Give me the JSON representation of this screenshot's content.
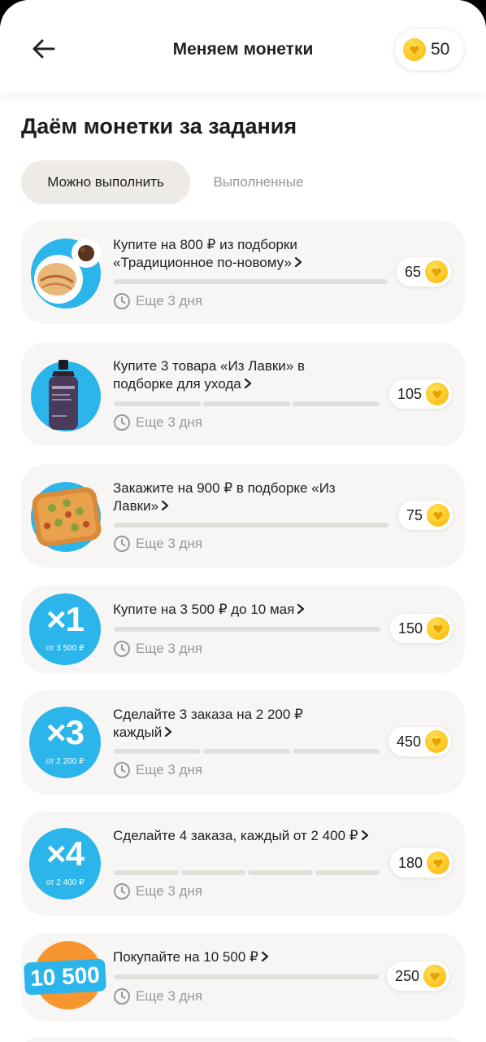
{
  "header": {
    "title": "Меняем монетки",
    "balance": "50"
  },
  "section_title": "Даём монетки за задания",
  "tabs": [
    {
      "label": "Можно выполнить",
      "active": true
    },
    {
      "label": "Выполненные",
      "active": false
    }
  ],
  "tasks": [
    {
      "text": "Купите на 800 ₽ из подборки «Традиционное по-новому»",
      "progress_done": 0,
      "progress_total": 1,
      "deadline": "Еще 3 дня",
      "reward": "65",
      "image": "pancakes-photo"
    },
    {
      "text": "Купите 3 товара «Из Лавки» в подборке для ухода",
      "progress_done": 0,
      "progress_total": 3,
      "deadline": "Еще 3 дня",
      "reward": "105",
      "image": "gel-bottle-photo"
    },
    {
      "text": "Закажите на 900 ₽ в подборке «Из Лавки»",
      "progress_done": 0,
      "progress_total": 1,
      "deadline": "Еще 3 дня",
      "reward": "75",
      "image": "pizza-photo"
    },
    {
      "text": "Купите на 3 500 ₽ до 10 мая",
      "progress_done": 0,
      "progress_total": 1,
      "deadline": "Еще 3 дня",
      "reward": "150",
      "badge": {
        "big": "×1",
        "small": "от 3 500 ₽"
      }
    },
    {
      "text": "Сделайте 3 заказа на 2 200 ₽ каждый",
      "progress_done": 0,
      "progress_total": 3,
      "deadline": "Еще 3 дня",
      "reward": "450",
      "badge": {
        "big": "×3",
        "small": "от 2 200 ₽"
      }
    },
    {
      "text": "Сделайте 4 заказа, каждый от 2 400 ₽",
      "progress_done": 0,
      "progress_total": 4,
      "deadline": "Еще 3 дня",
      "reward": "180",
      "badge": {
        "big": "×4",
        "small": "от 2 400 ₽"
      }
    },
    {
      "text": "Покупайте на 10 500 ₽",
      "progress_done": 0,
      "progress_total": 1,
      "deadline": "Еще 3 дня",
      "reward": "250",
      "badge": {
        "label": "10 500"
      }
    }
  ],
  "colors": {
    "accent_blue": "#2bb5ea",
    "coin_yellow": "#fcc21b",
    "card_bg": "#f7f6f4"
  }
}
